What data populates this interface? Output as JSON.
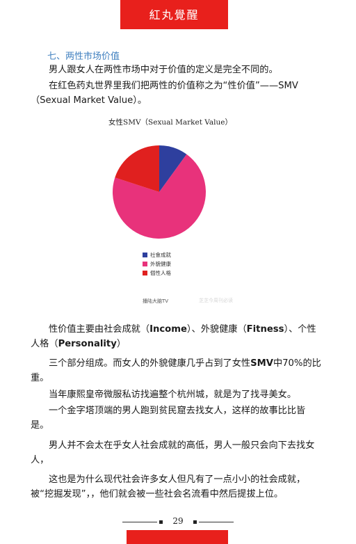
{
  "header": {
    "banner_text": "紅丸覺醒",
    "banner_color": "#e8201c"
  },
  "section": {
    "title": "七、两性市场价值",
    "title_color": "#3f7fbf"
  },
  "intro": {
    "p1": "男人跟女人在两性市场中对于价值的定义是完全不同的。",
    "p2": "在红色药丸世界里我们把两性的价值称之为“性价值”——SMV（Sexual Market Value）。"
  },
  "chart_data": {
    "type": "pie",
    "title": "女性SMV（Sexual Market Value）",
    "series": [
      {
        "name": "社會成就",
        "value": 10,
        "color": "#2e3f9e"
      },
      {
        "name": "外貌健康",
        "value": 70,
        "color": "#e8327b"
      },
      {
        "name": "個性人格",
        "value": 20,
        "color": "#e0201f"
      }
    ],
    "legend_position": "bottom-left",
    "watermarks": [
      "播陆大脑TV",
      "芝芝今周刊必读"
    ]
  },
  "body": {
    "p3_a": "性价值主要由社会成就（",
    "p3_income": "Income",
    "p3_b": "）、外貌健康（",
    "p3_fitness": "Fitness",
    "p3_c": "）、个性人格（",
    "p3_personality": "Personality",
    "p3_d": "）",
    "p4_a": "三个部分组成。而女人的外貌健康几乎占到了女性",
    "p4_smv": "SMV",
    "p4_b": "中70%的比重。",
    "p5": "当年康熙皇帝微服私访找遍整个杭州城，就是为了找寻美女。",
    "p6": "一个金字塔顶端的男人跑到贫民窟去找女人，这样的故事比比皆是。",
    "p7": "男人并不会太在乎女人社会成就的高低，男人一般只会向下去找女人，",
    "p8": "这也是为什么现代社会许多女人但凡有了一点小小的社会成就，被“挖掘发现”，，他们就会被一些社会名流看中然后提拔上位。"
  },
  "footer": {
    "page_number": "29"
  }
}
